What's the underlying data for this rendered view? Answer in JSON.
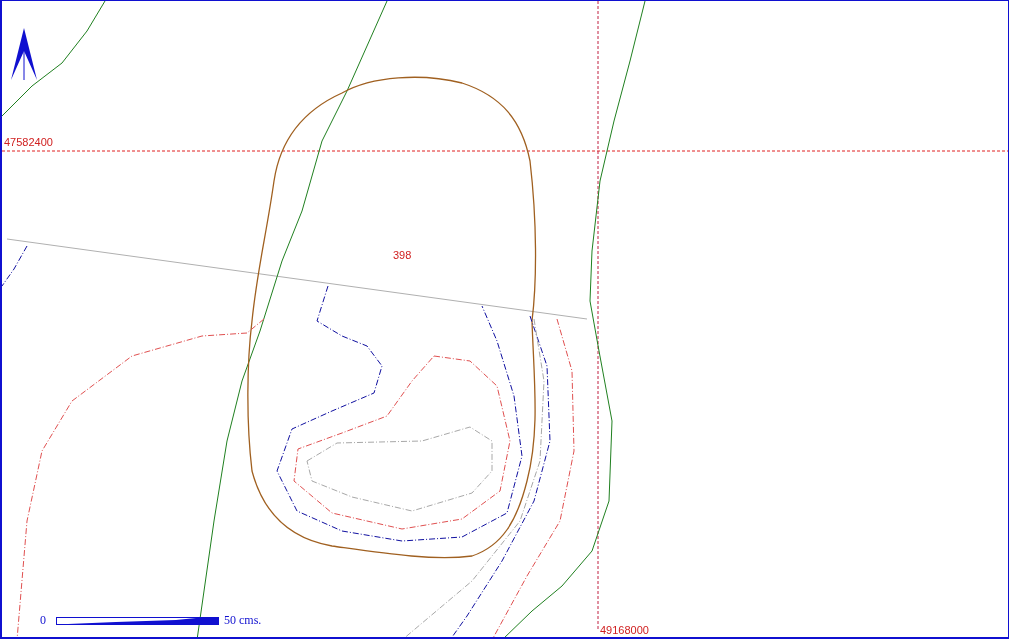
{
  "map": {
    "horizontal_grid_label": "47582400",
    "vertical_grid_label": "49168000",
    "feature_label": "398",
    "scale_bar": {
      "start": "0",
      "end": "50 cms."
    }
  }
}
